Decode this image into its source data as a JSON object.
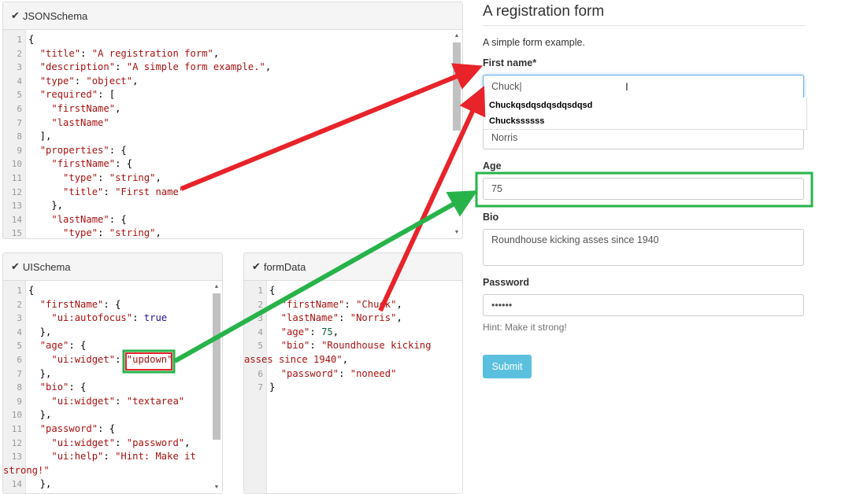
{
  "panels": {
    "jsonschema": {
      "title": "JSONSchema",
      "lines": [
        [
          "1",
          [
            [
              "p",
              "{"
            ]
          ]
        ],
        [
          "2",
          [
            [
              "p",
              "  "
            ],
            [
              "s",
              "\"title\""
            ],
            [
              "p",
              ": "
            ],
            [
              "s",
              "\"A registration form\""
            ],
            [
              "p",
              ","
            ]
          ]
        ],
        [
          "3",
          [
            [
              "p",
              "  "
            ],
            [
              "s",
              "\"description\""
            ],
            [
              "p",
              ": "
            ],
            [
              "s",
              "\"A simple form example.\""
            ],
            [
              "p",
              ","
            ]
          ]
        ],
        [
          "4",
          [
            [
              "p",
              "  "
            ],
            [
              "s",
              "\"type\""
            ],
            [
              "p",
              ": "
            ],
            [
              "s",
              "\"object\""
            ],
            [
              "p",
              ","
            ]
          ]
        ],
        [
          "5",
          [
            [
              "p",
              "  "
            ],
            [
              "s",
              "\"required\""
            ],
            [
              "p",
              ": ["
            ]
          ]
        ],
        [
          "6",
          [
            [
              "p",
              "    "
            ],
            [
              "s",
              "\"firstName\""
            ],
            [
              "p",
              ","
            ]
          ]
        ],
        [
          "7",
          [
            [
              "p",
              "    "
            ],
            [
              "s",
              "\"lastName\""
            ]
          ]
        ],
        [
          "8",
          [
            [
              "p",
              "  ],"
            ]
          ]
        ],
        [
          "9",
          [
            [
              "p",
              "  "
            ],
            [
              "s",
              "\"properties\""
            ],
            [
              "p",
              ": {"
            ]
          ]
        ],
        [
          "10",
          [
            [
              "p",
              "    "
            ],
            [
              "s",
              "\"firstName\""
            ],
            [
              "p",
              ": {"
            ]
          ]
        ],
        [
          "11",
          [
            [
              "p",
              "      "
            ],
            [
              "s",
              "\"type\""
            ],
            [
              "p",
              ": "
            ],
            [
              "s",
              "\"string\""
            ],
            [
              "p",
              ","
            ]
          ]
        ],
        [
          "12",
          [
            [
              "p",
              "      "
            ],
            [
              "s",
              "\"title\""
            ],
            [
              "p",
              ": "
            ],
            [
              "s",
              "\"First name\""
            ]
          ]
        ],
        [
          "13",
          [
            [
              "p",
              "    },"
            ]
          ]
        ],
        [
          "14",
          [
            [
              "p",
              "    "
            ],
            [
              "s",
              "\"lastName\""
            ],
            [
              "p",
              ": {"
            ]
          ]
        ],
        [
          "15",
          [
            [
              "p",
              "      "
            ],
            [
              "s",
              "\"type\""
            ],
            [
              "p",
              ": "
            ],
            [
              "s",
              "\"string\""
            ],
            [
              "p",
              ","
            ]
          ]
        ]
      ]
    },
    "uischema": {
      "title": "UISchema",
      "lines": [
        [
          "1",
          [
            [
              "p",
              "{"
            ]
          ]
        ],
        [
          "2",
          [
            [
              "p",
              "  "
            ],
            [
              "s",
              "\"firstName\""
            ],
            [
              "p",
              ": {"
            ]
          ]
        ],
        [
          "3",
          [
            [
              "p",
              "    "
            ],
            [
              "s",
              "\"ui:autofocus\""
            ],
            [
              "p",
              ": "
            ],
            [
              "k",
              "true"
            ]
          ]
        ],
        [
          "4",
          [
            [
              "p",
              "  },"
            ]
          ]
        ],
        [
          "5",
          [
            [
              "p",
              "  "
            ],
            [
              "s",
              "\"age\""
            ],
            [
              "p",
              ": {"
            ]
          ]
        ],
        [
          "6",
          [
            [
              "p",
              "    "
            ],
            [
              "s",
              "\"ui:widget\""
            ],
            [
              "p",
              ": "
            ],
            [
              "s",
              "\"updown\""
            ]
          ]
        ],
        [
          "7",
          [
            [
              "p",
              "  },"
            ]
          ]
        ],
        [
          "8",
          [
            [
              "p",
              "  "
            ],
            [
              "s",
              "\"bio\""
            ],
            [
              "p",
              ": {"
            ]
          ]
        ],
        [
          "9",
          [
            [
              "p",
              "    "
            ],
            [
              "s",
              "\"ui:widget\""
            ],
            [
              "p",
              ": "
            ],
            [
              "s",
              "\"textarea\""
            ]
          ]
        ],
        [
          "10",
          [
            [
              "p",
              "  },"
            ]
          ]
        ],
        [
          "11",
          [
            [
              "p",
              "  "
            ],
            [
              "s",
              "\"password\""
            ],
            [
              "p",
              ": {"
            ]
          ]
        ],
        [
          "12",
          [
            [
              "p",
              "    "
            ],
            [
              "s",
              "\"ui:widget\""
            ],
            [
              "p",
              ": "
            ],
            [
              "s",
              "\"password\""
            ],
            [
              "p",
              ","
            ]
          ]
        ],
        [
          "13",
          [
            [
              "p",
              "    "
            ],
            [
              "s",
              "\"ui:help\""
            ],
            [
              "p",
              ": "
            ],
            [
              "s",
              "\"Hint: Make it"
            ]
          ]
        ],
        [
          "",
          [
            [
              "s",
              "strong!\""
            ]
          ]
        ],
        [
          "14",
          [
            [
              "p",
              "  },"
            ]
          ]
        ]
      ]
    },
    "formdata": {
      "title": "formData",
      "lines": [
        [
          "1",
          [
            [
              "p",
              "{"
            ]
          ]
        ],
        [
          "2",
          [
            [
              "p",
              "  "
            ],
            [
              "s",
              "\"firstName\""
            ],
            [
              "p",
              ": "
            ],
            [
              "s",
              "\"Chuck\""
            ],
            [
              "p",
              ","
            ]
          ]
        ],
        [
          "3",
          [
            [
              "p",
              "  "
            ],
            [
              "s",
              "\"lastName\""
            ],
            [
              "p",
              ": "
            ],
            [
              "s",
              "\"Norris\""
            ],
            [
              "p",
              ","
            ]
          ]
        ],
        [
          "4",
          [
            [
              "p",
              "  "
            ],
            [
              "s",
              "\"age\""
            ],
            [
              "p",
              ": "
            ],
            [
              "n",
              "75"
            ],
            [
              "p",
              ","
            ]
          ]
        ],
        [
          "5",
          [
            [
              "p",
              "  "
            ],
            [
              "s",
              "\"bio\""
            ],
            [
              "p",
              ": "
            ],
            [
              "s",
              "\"Roundhouse kicking"
            ]
          ]
        ],
        [
          "",
          [
            [
              "s",
              "asses since 1940\""
            ],
            [
              "p",
              ","
            ]
          ]
        ],
        [
          "6",
          [
            [
              "p",
              "  "
            ],
            [
              "s",
              "\"password\""
            ],
            [
              "p",
              ": "
            ],
            [
              "s",
              "\"noneed\""
            ]
          ]
        ],
        [
          "7",
          [
            [
              "p",
              "}"
            ]
          ]
        ]
      ]
    }
  },
  "form": {
    "title": "A registration form",
    "description": "A simple form example.",
    "first_name_label": "First name*",
    "first_name_value": "Chuck|",
    "autocomplete": [
      "Chuckqsdqsdqsdqsdqsd",
      "Chuckssssss"
    ],
    "last_name_value": "Norris",
    "age_label": "Age",
    "age_value": "75",
    "bio_label": "Bio",
    "bio_value": "Roundhouse kicking asses since 1940",
    "password_label": "Password",
    "password_value": "••••••",
    "password_help": "Hint: Make it strong!",
    "submit_label": "Submit"
  },
  "icons": {
    "panel_check": "checkmark-icon",
    "cursor": "text-cursor-icon"
  },
  "colors": {
    "arrow_red": "#e8232a",
    "arrow_green": "#27b34a",
    "submit": "#5bc0de",
    "focus": "#66afe9"
  }
}
